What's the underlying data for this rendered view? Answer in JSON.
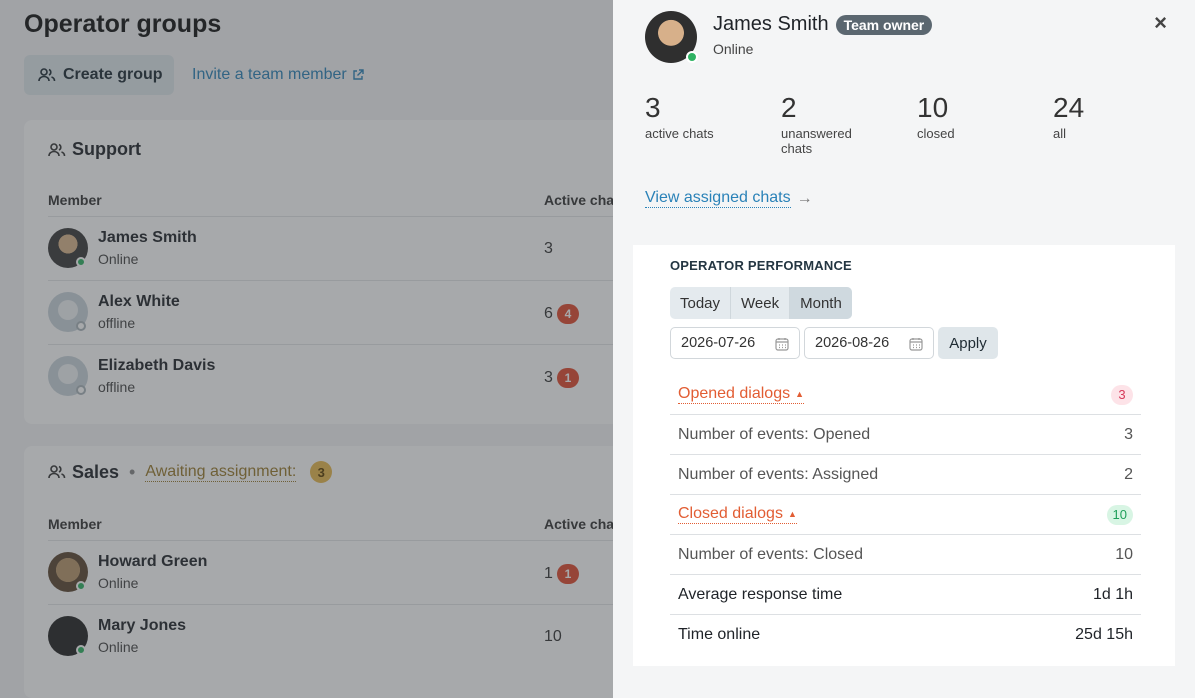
{
  "page": {
    "title": "Operator groups",
    "create_group": "Create group",
    "invite": "Invite a team member"
  },
  "groups": [
    {
      "name": "Support",
      "col_member": "Member",
      "col_active": "Active cha",
      "members": [
        {
          "name": "James Smith",
          "status": "Online",
          "count": "3",
          "badge": ""
        },
        {
          "name": "Alex White",
          "status": "offline",
          "count": "6",
          "badge": "4"
        },
        {
          "name": "Elizabeth Davis",
          "status": "offline",
          "count": "3",
          "badge": "1"
        }
      ]
    },
    {
      "name": "Sales",
      "awaiting_label": "Awaiting assignment:",
      "awaiting_count": "3",
      "col_member": "Member",
      "col_active": "Active cha",
      "members": [
        {
          "name": "Howard Green",
          "status": "Online",
          "count": "1",
          "badge": "1"
        },
        {
          "name": "Mary Jones",
          "status": "Online",
          "count": "10",
          "badge": ""
        }
      ]
    }
  ],
  "panel": {
    "name": "James Smith",
    "role_badge": "Team owner",
    "status": "Online",
    "close": "×",
    "stats": [
      {
        "value": "3",
        "label": "active chats"
      },
      {
        "value": "2",
        "label": "unanswered chats"
      },
      {
        "value": "10",
        "label": "closed"
      },
      {
        "value": "24",
        "label": "all"
      }
    ],
    "view_link": "View assigned chats",
    "view_arrow": "→",
    "performance": {
      "title": "OPERATOR PERFORMANCE",
      "periods": [
        "Today",
        "Week",
        "Month"
      ],
      "active_period": "Month",
      "date_from": "2026-07-26",
      "date_to": "2026-08-26",
      "apply": "Apply",
      "opened": {
        "label": "Opened dialogs",
        "count": "3"
      },
      "opened_rows": [
        {
          "label": "Number of events: Opened",
          "value": "3"
        },
        {
          "label": "Number of events: Assigned",
          "value": "2"
        }
      ],
      "closed": {
        "label": "Closed dialogs",
        "count": "10"
      },
      "closed_rows": [
        {
          "label": "Number of events: Closed",
          "value": "10"
        }
      ],
      "avg_response": {
        "label": "Average response time",
        "value": "1d 1h"
      },
      "time_online": {
        "label": "Time online",
        "value": "25d 15h"
      }
    }
  },
  "colors": {
    "accent_link": "#2a82b8",
    "online": "#2fb363",
    "danger_badge": "#e0492f",
    "section_link": "#e25d33"
  }
}
